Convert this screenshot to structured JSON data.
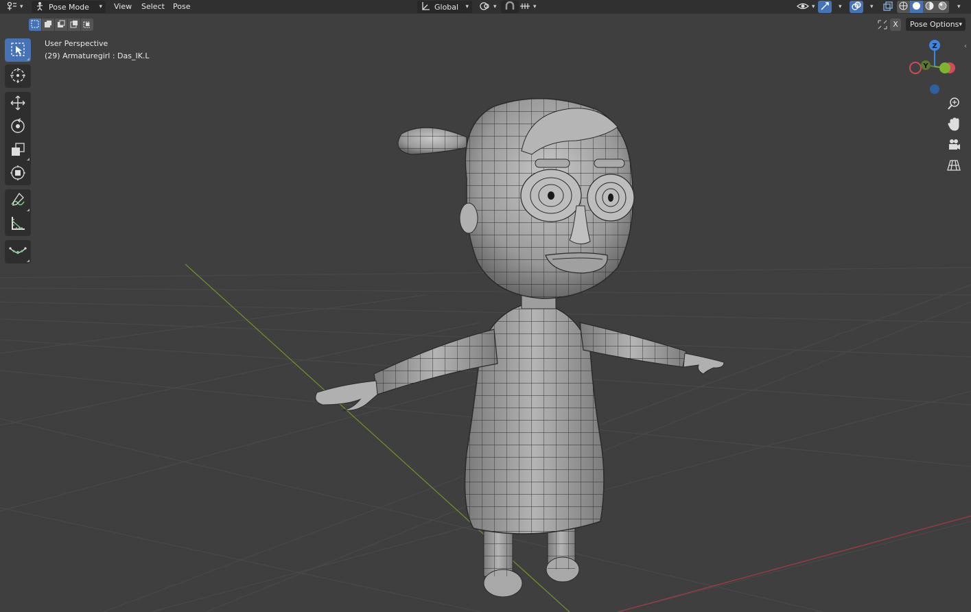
{
  "header": {
    "mode_label": "Pose Mode",
    "menus": [
      "View",
      "Select",
      "Pose"
    ],
    "orientation_label": "Global",
    "pose_options_label": "Pose Options",
    "x_label": "X"
  },
  "overlay": {
    "view_name": "User Perspective",
    "active_object": "(29) Armaturegirl : Das_IK.L"
  },
  "gizmo": {
    "z_label": "Z",
    "y_label": "Y"
  },
  "colors": {
    "accent": "#4772b3",
    "x_axis": "#d24a5c",
    "y_axis": "#7fb432",
    "z_axis": "#3e87de",
    "header_bg": "#303030",
    "viewport_bg": "#3f3f3f"
  },
  "icons": {
    "editor_type": "editor-type-icon",
    "pose_mode": "pose-mode-icon",
    "orientation": "transform-orientation-icon",
    "pivot": "pivot-point-icon",
    "snap": "snap-icon",
    "visibility": "visibility-icon",
    "gizmos": "gizmos-icon",
    "overlays": "overlays-icon",
    "xray": "xray-icon"
  },
  "tools": [
    "select-box-tool",
    "cursor-tool",
    "move-tool",
    "rotate-tool",
    "scale-tool",
    "transform-tool",
    "annotate-tool",
    "measure-tool",
    "relax-pose-tool"
  ]
}
